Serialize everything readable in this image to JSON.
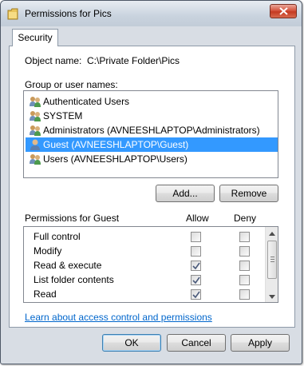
{
  "window": {
    "title": "Permissions for Pics"
  },
  "tabs": [
    {
      "label": "Security"
    }
  ],
  "object": {
    "label": "Object name:",
    "value": "C:\\Private Folder\\Pics"
  },
  "groups": {
    "label": "Group or user names:",
    "items": [
      {
        "label": "Authenticated Users",
        "selected": false,
        "icon": "group-icon"
      },
      {
        "label": "SYSTEM",
        "selected": false,
        "icon": "group-icon"
      },
      {
        "label": "Administrators (AVNEESHLAPTOP\\Administrators)",
        "selected": false,
        "icon": "group-icon"
      },
      {
        "label": "Guest (AVNEESHLAPTOP\\Guest)",
        "selected": true,
        "icon": "user-icon"
      },
      {
        "label": "Users (AVNEESHLAPTOP\\Users)",
        "selected": false,
        "icon": "group-icon"
      }
    ]
  },
  "buttons": {
    "add": "Add...",
    "remove": "Remove",
    "ok": "OK",
    "cancel": "Cancel",
    "apply": "Apply"
  },
  "permissions": {
    "label": "Permissions for Guest",
    "allow_header": "Allow",
    "deny_header": "Deny",
    "rows": [
      {
        "name": "Full control",
        "allow": false,
        "deny": false
      },
      {
        "name": "Modify",
        "allow": false,
        "deny": false
      },
      {
        "name": "Read & execute",
        "allow": true,
        "deny": false
      },
      {
        "name": "List folder contents",
        "allow": true,
        "deny": false
      },
      {
        "name": "Read",
        "allow": true,
        "deny": false
      }
    ]
  },
  "help_link": "Learn about access control and permissions",
  "colors": {
    "selection": "#3399ff",
    "link": "#0066cc",
    "close_button": "#c43a22"
  }
}
